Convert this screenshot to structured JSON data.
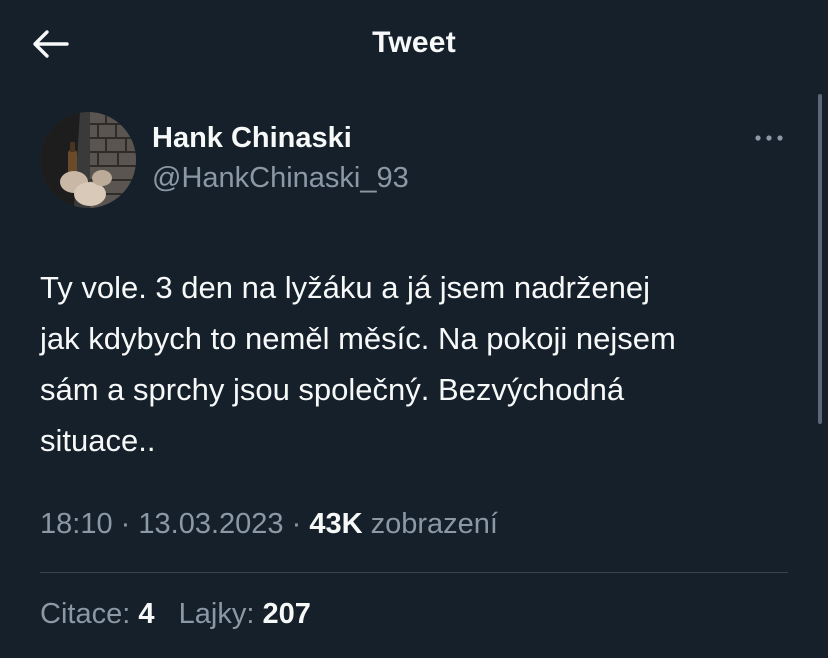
{
  "header": {
    "title": "Tweet",
    "back_icon": "arrow-left-icon"
  },
  "author": {
    "name": "Hank Chinaski",
    "handle": "@HankChinaski_93",
    "avatar": "avatar-photo"
  },
  "more_icon": "more-horizontal-icon",
  "tweet": {
    "lines": [
      "Ty vole. 3 den na lyžáku a já jsem nadrženej",
      "jak kdybych to neměl měsíc. Na pokoji nejsem",
      "sám a sprchy jsou společný. Bezvýchodná",
      "situace.."
    ]
  },
  "meta": {
    "time": "18:10",
    "separator": "·",
    "date": "13.03.2023",
    "views_count": "43K",
    "views_label": "zobrazení"
  },
  "stats": {
    "quotes_label": "Citace:",
    "quotes_count": "4",
    "likes_label": "Lajky:",
    "likes_count": "207"
  },
  "colors": {
    "background": "#15202b",
    "text_primary": "#f7f9f9",
    "text_secondary": "#8b98a5",
    "divider": "#38444d"
  }
}
